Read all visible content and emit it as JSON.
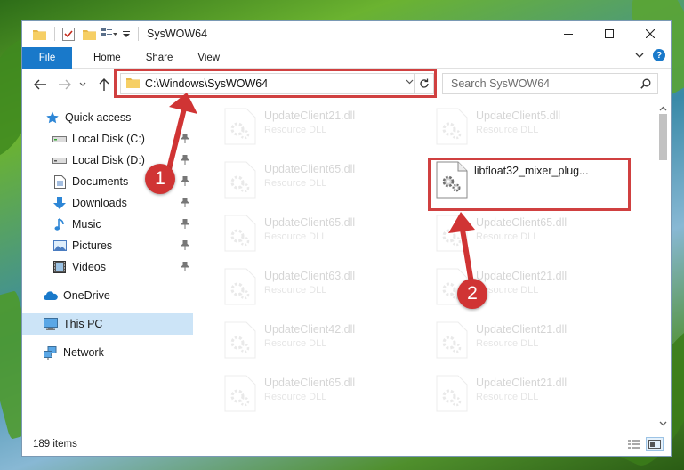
{
  "window": {
    "title": "SysWOW64"
  },
  "ribbon": {
    "tabs": [
      "File",
      "Home",
      "Share",
      "View"
    ]
  },
  "address": {
    "path": "C:\\Windows\\SysWOW64"
  },
  "search": {
    "placeholder": "Search SysWOW64"
  },
  "sidebar": {
    "items": [
      {
        "label": "Quick access",
        "icon": "star-icon",
        "pinned": false
      },
      {
        "label": "Local Disk (C:)",
        "icon": "drive-icon",
        "pinned": true
      },
      {
        "label": "Local Disk (D:)",
        "icon": "drive-icon",
        "pinned": true
      },
      {
        "label": "Documents",
        "icon": "documents-icon",
        "pinned": true
      },
      {
        "label": "Downloads",
        "icon": "downloads-icon",
        "pinned": true
      },
      {
        "label": "Music",
        "icon": "music-icon",
        "pinned": true
      },
      {
        "label": "Pictures",
        "icon": "pictures-icon",
        "pinned": true
      },
      {
        "label": "Videos",
        "icon": "videos-icon",
        "pinned": true
      },
      {
        "label": "OneDrive",
        "icon": "cloud-icon",
        "pinned": false
      },
      {
        "label": "This PC",
        "icon": "computer-icon",
        "pinned": false,
        "selected": true
      },
      {
        "label": "Network",
        "icon": "network-icon",
        "pinned": false
      }
    ]
  },
  "files": [
    {
      "name": "UpdateClient21.dll",
      "type": "Resource DLL",
      "faded": true
    },
    {
      "name": "UpdateClient5.dll",
      "type": "Resource DLL",
      "faded": true
    },
    {
      "name": "UpdateClient65.dll",
      "type": "Resource DLL",
      "faded": true
    },
    {
      "name": "libfloat32_mixer_plug...",
      "type": "",
      "faded": false
    },
    {
      "name": "UpdateClient65.dll",
      "type": "Resource DLL",
      "faded": true
    },
    {
      "name": "UpdateClient65.dll",
      "type": "Resource DLL",
      "faded": true
    },
    {
      "name": "UpdateClient63.dll",
      "type": "Resource DLL",
      "faded": true
    },
    {
      "name": "UpdateClient21.dll",
      "type": "Resource DLL",
      "faded": true
    },
    {
      "name": "UpdateClient42.dll",
      "type": "Resource DLL",
      "faded": true
    },
    {
      "name": "UpdateClient21.dll",
      "type": "Resource DLL",
      "faded": true
    },
    {
      "name": "UpdateClient65.dll",
      "type": "Resource DLL",
      "faded": true
    },
    {
      "name": "UpdateClient21.dll",
      "type": "Resource DLL",
      "faded": true
    }
  ],
  "status": {
    "item_count": "189 items"
  },
  "annotations": {
    "callout_1": "1",
    "callout_2": "2",
    "highlight_color": "#d04040"
  },
  "colors": {
    "accent": "#1979ca",
    "selection": "#cce4f7"
  }
}
